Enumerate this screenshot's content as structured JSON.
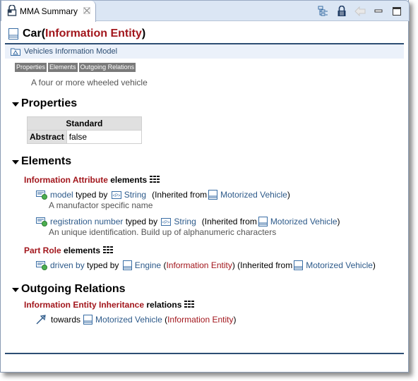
{
  "tab": {
    "title": "MMA Summary",
    "close_icon": "close-icon",
    "icon": "lock-icon"
  },
  "toolbar": {
    "buttons": [
      {
        "name": "hierarchy-icon"
      },
      {
        "name": "pin-lock-icon"
      },
      {
        "name": "back-arrow-icon"
      },
      {
        "name": "minimize-icon"
      },
      {
        "name": "maximize-icon"
      }
    ]
  },
  "header": {
    "name": "Car",
    "open_paren": " (",
    "type": "Information Entity",
    "close_paren": ")"
  },
  "model": {
    "label": "Vehicles Information Model"
  },
  "anchors": [
    "Properties",
    "Elements",
    "Outgoing Relations"
  ],
  "description": "A four or more wheeled vehicle",
  "properties": {
    "title": "Properties",
    "table_header": "Standard",
    "rows": [
      {
        "key": "Abstract",
        "value": "false"
      }
    ]
  },
  "elements": {
    "title": "Elements",
    "groups": [
      {
        "type": "Information Attribute",
        "suffix": " elements",
        "items": [
          {
            "name": "model",
            "typed_by": " typed by ",
            "type": "String",
            "inherited": "(Inherited from",
            "from": "Motorized Vehicle",
            "close": ")",
            "description": "A manufactor specific name"
          },
          {
            "name": "registration number",
            "typed_by": " typed by ",
            "type": "String",
            "inherited": "(Inherited from",
            "from": "Motorized Vehicle",
            "close": ")",
            "description": "An unique identification. Build up of alphanumeric characters"
          }
        ]
      },
      {
        "type": "Part Role",
        "suffix": " elements",
        "items": [
          {
            "name": "driven by",
            "typed_by": " typed by ",
            "type": "Engine",
            "type_kind_open": " (",
            "type_kind": "Information Entity",
            "type_kind_close": ")",
            "inherited": " (Inherited from",
            "from": "Motorized Vehicle",
            "close": ")"
          }
        ]
      }
    ]
  },
  "relations": {
    "title": "Outgoing Relations",
    "groups": [
      {
        "type": "Information Entity Inheritance",
        "suffix": " relations",
        "items": [
          {
            "label": "towards",
            "target": "Motorized Vehicle",
            "open": " (",
            "kind": "Information Entity",
            "close": ")"
          }
        ]
      }
    ]
  }
}
